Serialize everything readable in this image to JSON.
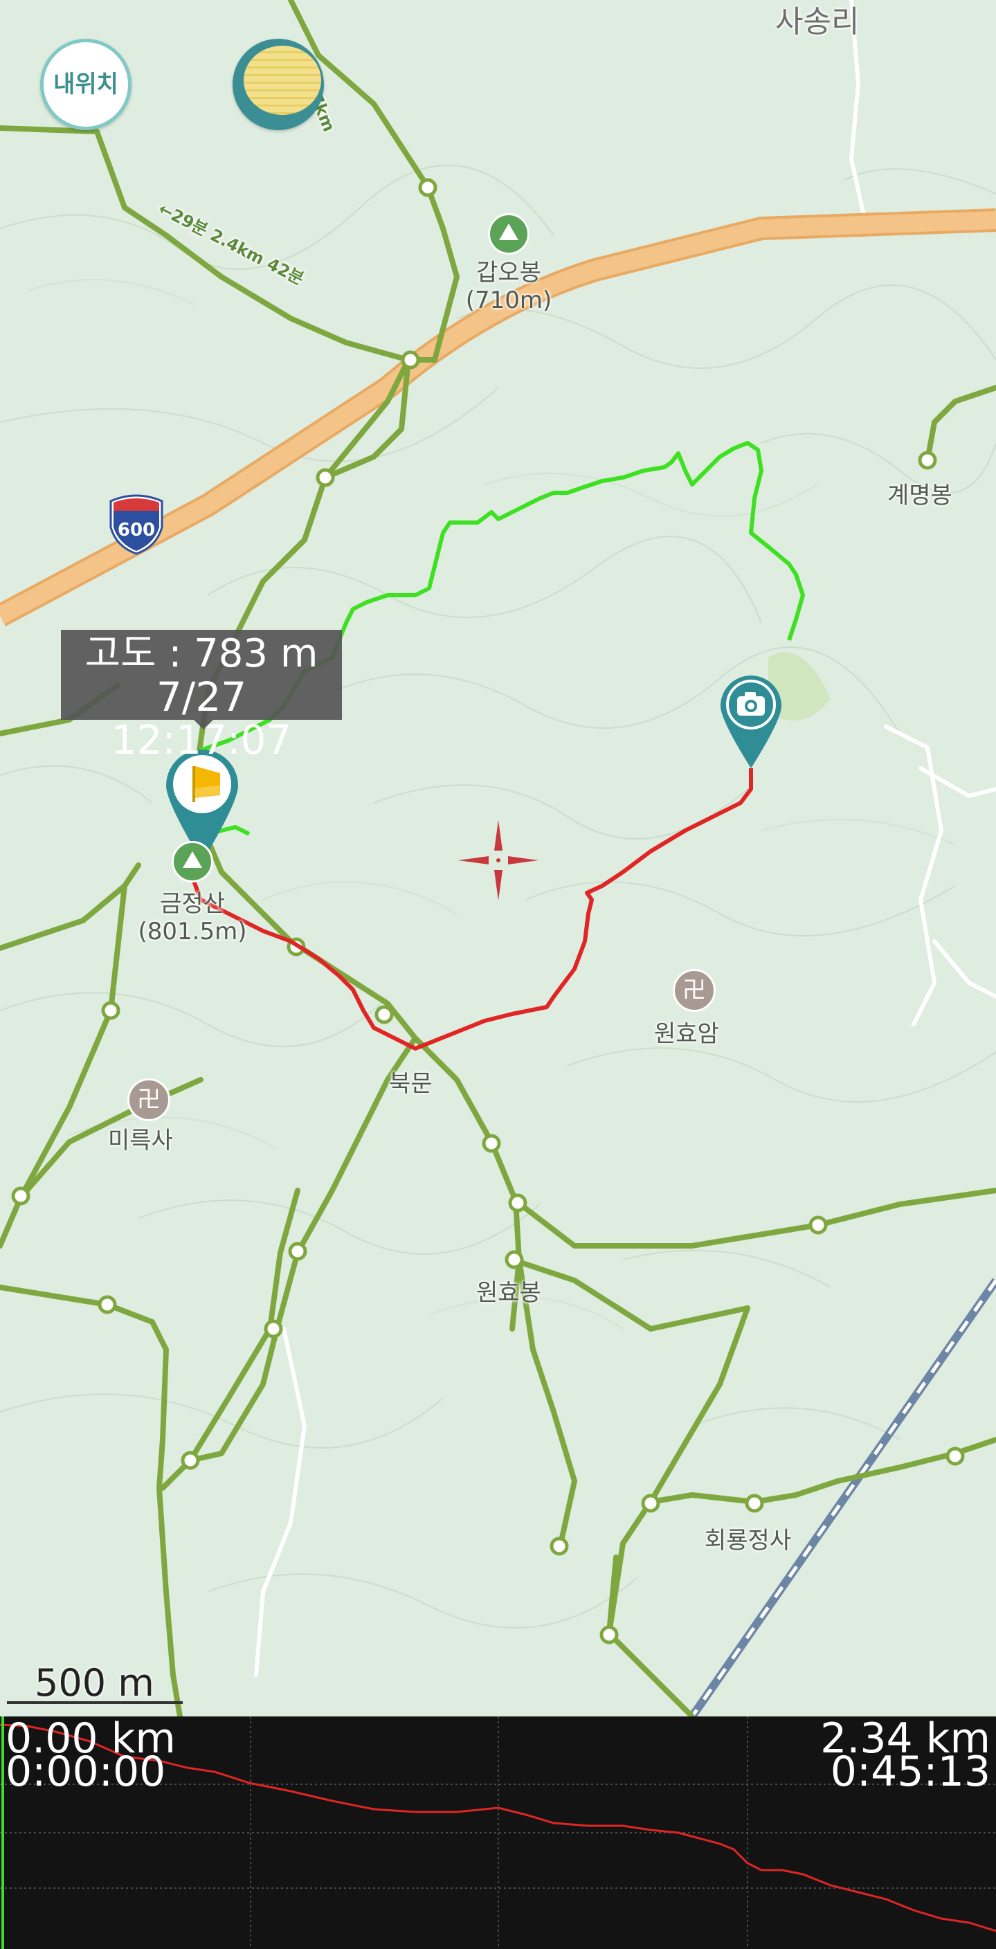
{
  "map": {
    "labels": {
      "village_sasong": "사송리",
      "peak_gapobong_name": "갑오봉",
      "peak_gapobong_elev": "(710m)",
      "peak_gyemyeong": "계명봉",
      "peak_geumjeong_name": "금정산",
      "peak_geumjeong_elev": "(801.5m)",
      "gate_bukmun": "북문",
      "temple_wonhyoam": "원효암",
      "temple_mireuksa": "미륵사",
      "peak_wonhyobong": "원효봉",
      "temple_hoeryongjeongsa": "회룡정사",
      "trail_dist_1": "~13.7km",
      "trail_dist_2": "←29분 2.4km 42분",
      "highway_number": "600"
    },
    "icons": {
      "peak": "mountain-peak-icon",
      "temple": "buddhist-temple-icon",
      "start_marker": "start-flag-marker-icon",
      "photo_marker": "camera-marker-icon",
      "crosshair": "map-center-crosshair-icon",
      "temple_glyph": "卍"
    },
    "buttons": {
      "my_location_label": "내위치",
      "layer_icon": "layer-toggle-icon"
    },
    "tooltip": {
      "altitude": "고도 : 783 m",
      "timestamp": "7/27 12:17:07"
    },
    "scale_bar": {
      "label": "500 m"
    },
    "colors": {
      "background": "#dfece0",
      "trail": "#7ea83f",
      "track_recorded": "#e02525",
      "track_planned": "#3ee022",
      "highway": "#f4c387",
      "marker": "#2f8d96",
      "railway": "#6d86a6"
    }
  },
  "profile": {
    "start_distance": "0.00 km",
    "start_time": "0:00:00",
    "end_distance": "2.34 km",
    "end_time": "0:45:13",
    "line_color": "#e02525",
    "cursor_color": "#3ee022"
  }
}
